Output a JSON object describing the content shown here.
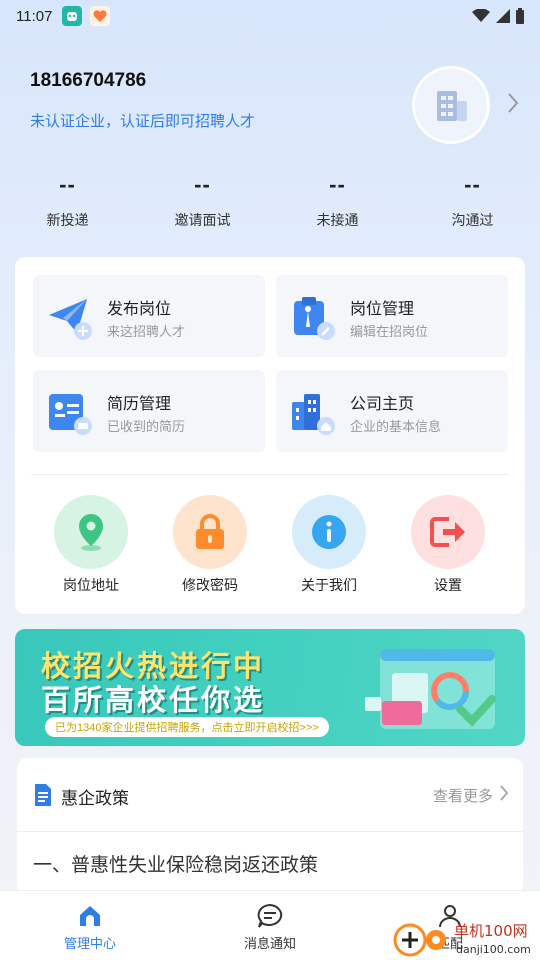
{
  "status_bar": {
    "time": "11:07"
  },
  "profile": {
    "phone": "18166704786",
    "cert_hint": "未认证企业，认证后即可招聘人才"
  },
  "stats": [
    {
      "value": "--",
      "label": "新投递"
    },
    {
      "value": "--",
      "label": "邀请面试"
    },
    {
      "value": "--",
      "label": "未接通"
    },
    {
      "value": "--",
      "label": "沟通过"
    }
  ],
  "tiles": [
    {
      "title": "发布岗位",
      "subtitle": "来这招聘人才",
      "icon": "paper-plane-icon"
    },
    {
      "title": "岗位管理",
      "subtitle": "编辑在招岗位",
      "icon": "job-manage-icon"
    },
    {
      "title": "简历管理",
      "subtitle": "已收到的简历",
      "icon": "resume-icon"
    },
    {
      "title": "公司主页",
      "subtitle": "企业的基本信息",
      "icon": "company-building-icon"
    }
  ],
  "quick_actions": [
    {
      "label": "岗位地址",
      "icon": "location-pin-icon",
      "color": "#3fc483"
    },
    {
      "label": "修改密码",
      "icon": "lock-icon",
      "color": "#ff8c2c"
    },
    {
      "label": "关于我们",
      "icon": "info-icon",
      "color": "#35a6ef"
    },
    {
      "label": "设置",
      "icon": "exit-settings-icon",
      "color": "#f5504f"
    }
  ],
  "banner": {
    "line1": "校招火热进行中",
    "line2": "百所高校任你选",
    "note": "已为1340家企业提供招聘服务，点击立即开启校招>>>"
  },
  "policy": {
    "title": "惠企政策",
    "more": "查看更多",
    "items": [
      "一、普惠性失业保险稳岗返还政策"
    ]
  },
  "tabbar": [
    {
      "label": "管理中心",
      "active": true,
      "icon": "home-icon"
    },
    {
      "label": "消息通知",
      "active": false,
      "icon": "chat-icon"
    },
    {
      "label": "匹配",
      "active": false,
      "icon": "person-icon"
    }
  ],
  "watermark": {
    "brand": "单机100网",
    "url": "danji100.com"
  },
  "colors": {
    "accent": "#2f7ee6",
    "tile_bg": "#f4f6fa"
  }
}
